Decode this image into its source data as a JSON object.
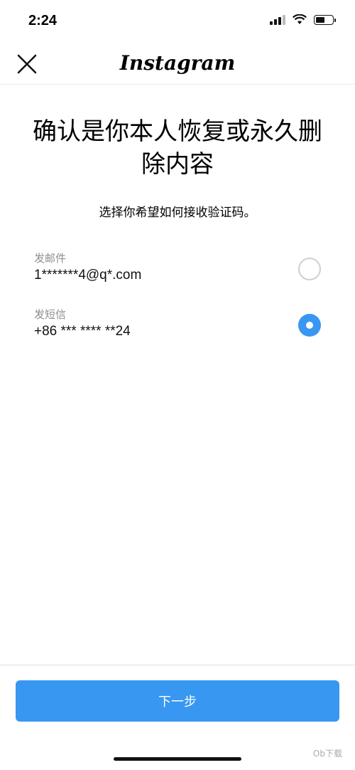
{
  "status_bar": {
    "time": "2:24"
  },
  "header": {
    "logo": "Instagram"
  },
  "main": {
    "title": "确认是你本人恢复或永久删除内容",
    "subtitle": "选择你希望如何接收验证码。",
    "options": [
      {
        "label": "发邮件",
        "value": "1*******4@q*.com",
        "selected": false
      },
      {
        "label": "发短信",
        "value": "+86 *** **** **24",
        "selected": true
      }
    ]
  },
  "footer": {
    "next_button": "下一步"
  },
  "watermark": "Ob下载",
  "colors": {
    "accent": "#3897f0"
  },
  "icons": [
    "close-icon",
    "cellular-signal-icon",
    "wifi-icon",
    "battery-icon"
  ]
}
